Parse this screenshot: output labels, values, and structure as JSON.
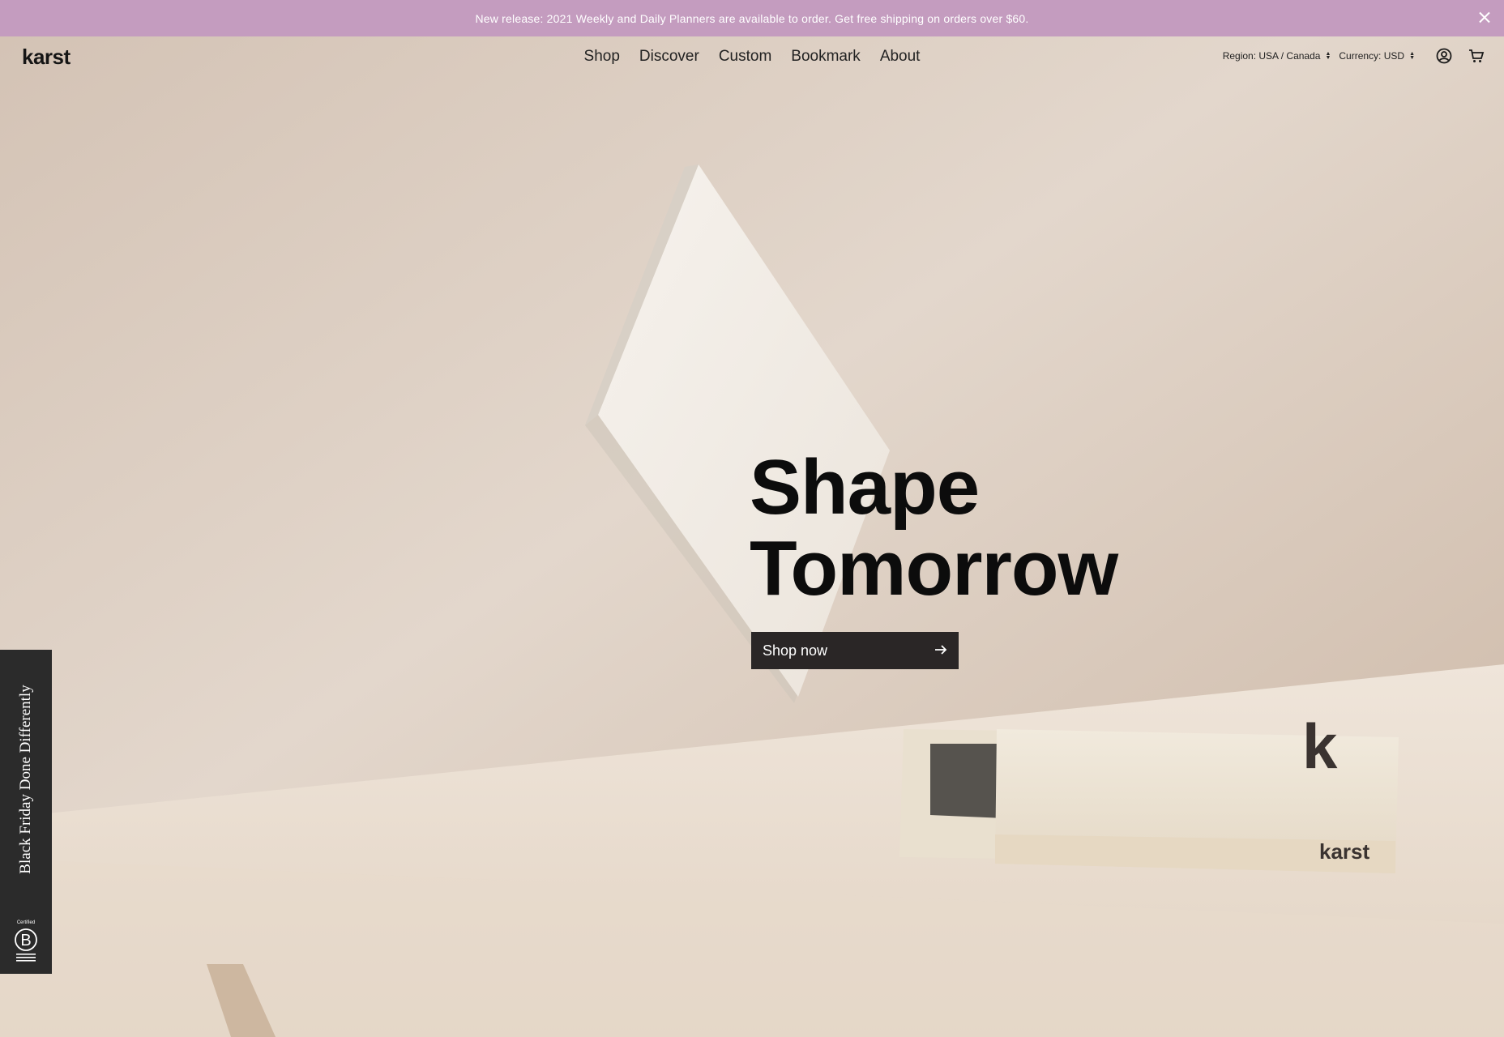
{
  "announcement": {
    "text": "New release: 2021 Weekly and Daily Planners are available to order. Get free shipping on orders over $60.",
    "background": "#c49cbf"
  },
  "header": {
    "logo": "karst",
    "nav": [
      "Shop",
      "Discover",
      "Custom",
      "Bookmark",
      "About"
    ],
    "region_label": "Region: USA / Canada",
    "currency_label": "Currency: USD",
    "icons": [
      "account-icon",
      "cart-icon"
    ]
  },
  "hero": {
    "title_line1": "Shape",
    "title_line2": "Tomorrow",
    "cta_label": "Shop now",
    "cta_icon": "arrow-right-icon",
    "product_box_brand": "karst",
    "product_box_mark": "k"
  },
  "side_tab": {
    "text": "Black Friday Done Differently",
    "badge_small": "Certified",
    "badge_letter": "B"
  },
  "colors": {
    "accent": "#c49cbf",
    "button": "#2a2626",
    "side_tab": "#2b2b2b"
  }
}
